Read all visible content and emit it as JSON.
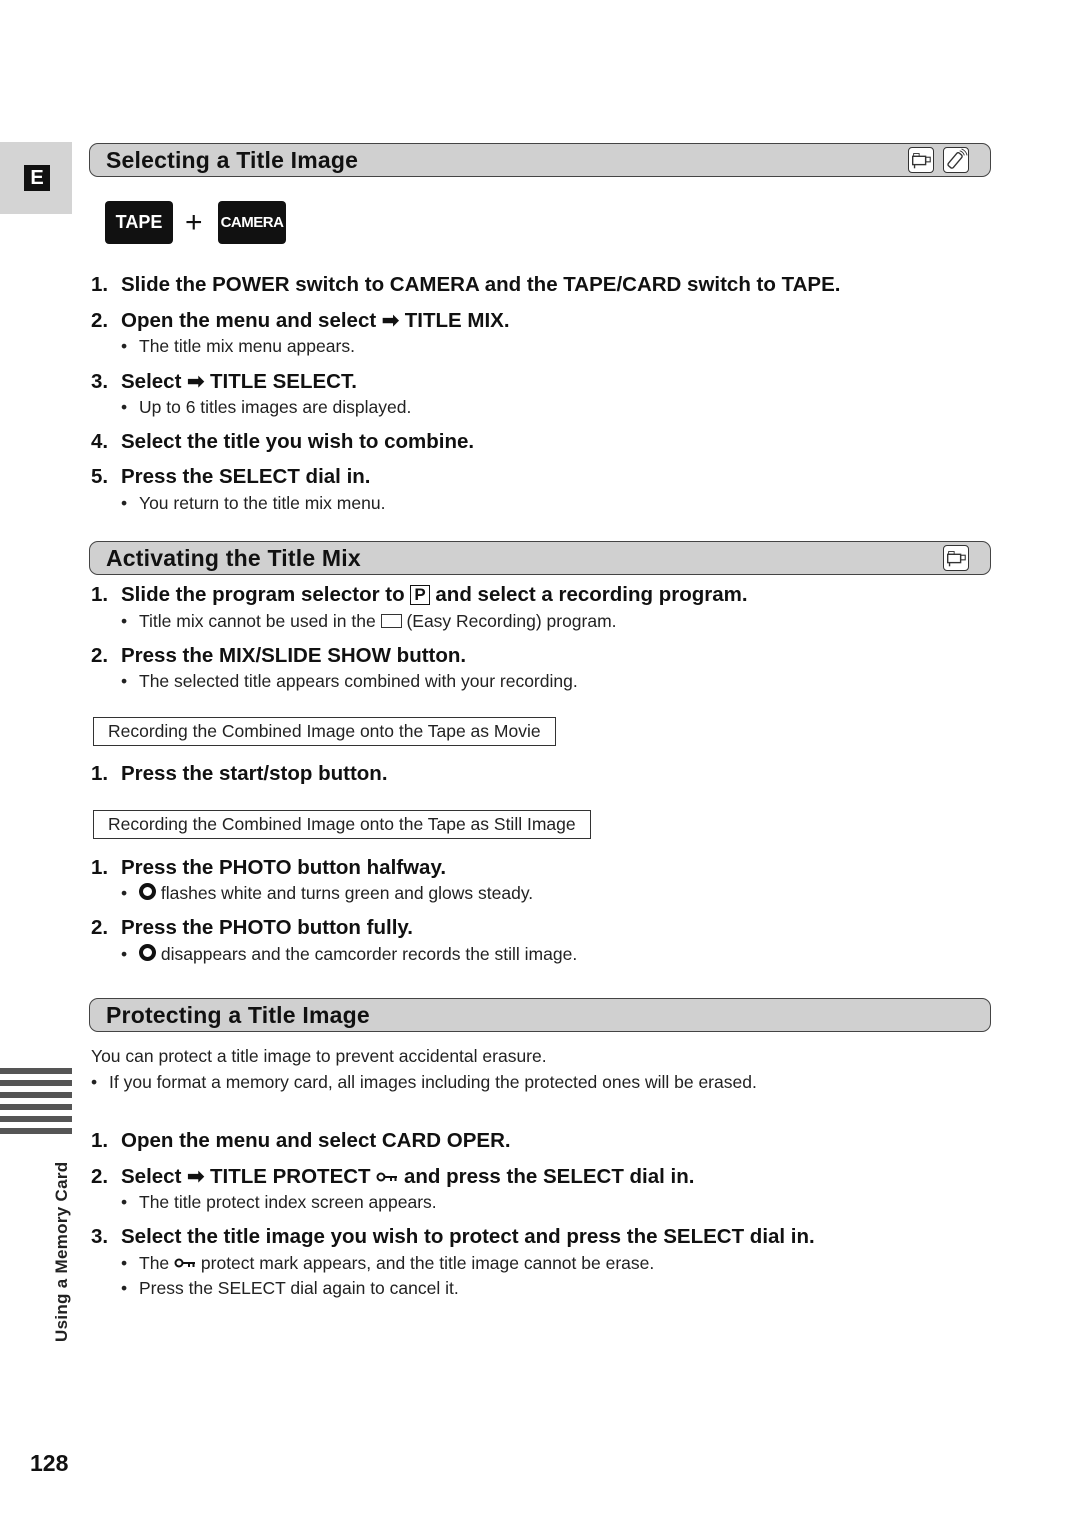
{
  "language_tab": "E",
  "sections": {
    "selecting": {
      "title": "Selecting a Title Image",
      "icons": [
        "camcorder-icon",
        "remote-control-icon"
      ],
      "mode_badges": {
        "tape": "TAPE",
        "plus": "+",
        "camera": "CAMERA"
      },
      "steps": [
        {
          "num": "1.",
          "text": "Slide the POWER switch to CAMERA and the TAPE/CARD switch to TAPE."
        },
        {
          "num": "2.",
          "text_before": "Open the menu and select",
          "arrow": "➡",
          "text_after": "TITLE MIX.",
          "note": "The title mix menu appears."
        },
        {
          "num": "3.",
          "text_before": "Select",
          "arrow": "➡",
          "text_after": "TITLE SELECT.",
          "note": "Up to 6 titles images are displayed."
        },
        {
          "num": "4.",
          "text": "Select the title you wish to combine."
        },
        {
          "num": "5.",
          "text": "Press the SELECT dial in.",
          "note": "You return to the title mix menu."
        }
      ]
    },
    "activating": {
      "title": "Activating the Title Mix",
      "icons": [
        "camcorder-icon"
      ],
      "steps": [
        {
          "num": "1.",
          "text_before": "Slide the program selector to",
          "boxed": "P",
          "text_after": "and select a recording program.",
          "note_before": "Title mix cannot be used in the",
          "note_after": "(Easy Recording) program."
        },
        {
          "num": "2.",
          "text": "Press the MIX/SLIDE SHOW button.",
          "note": "The selected title appears combined with your recording."
        }
      ],
      "movie_box": "Recording the Combined Image onto the Tape as Movie",
      "movie_steps": [
        {
          "num": "1.",
          "text": "Press the start/stop button."
        }
      ],
      "still_box": "Recording the Combined Image onto the Tape as Still Image",
      "still_steps": [
        {
          "num": "1.",
          "text": "Press the PHOTO button halfway.",
          "note": "flashes white and turns green and glows steady."
        },
        {
          "num": "2.",
          "text": "Press the PHOTO button fully.",
          "note": "disappears and the camcorder records the still image."
        }
      ]
    },
    "protecting": {
      "title": "Protecting a Title Image",
      "intro": "You can protect a title image to prevent accidental erasure.",
      "intro_note": "If you format a memory card, all images including the protected ones will be erased.",
      "steps": [
        {
          "num": "1.",
          "text": "Open the menu and select CARD OPER."
        },
        {
          "num": "2.",
          "text_before": "Select",
          "arrow": "➡",
          "text_mid": "TITLE PROTECT",
          "text_after": "and press the SELECT dial in.",
          "note": "The title protect index screen appears."
        },
        {
          "num": "3.",
          "text": "Select the title image you wish to protect and press the SELECT dial in.",
          "note1_before": "The",
          "note1_after": "protect mark appears, and the title image cannot be erase.",
          "note2": "Press the SELECT dial again to cancel it."
        }
      ]
    }
  },
  "bullet": "•",
  "side_label": "Using a Memory Card",
  "page_number": "128"
}
